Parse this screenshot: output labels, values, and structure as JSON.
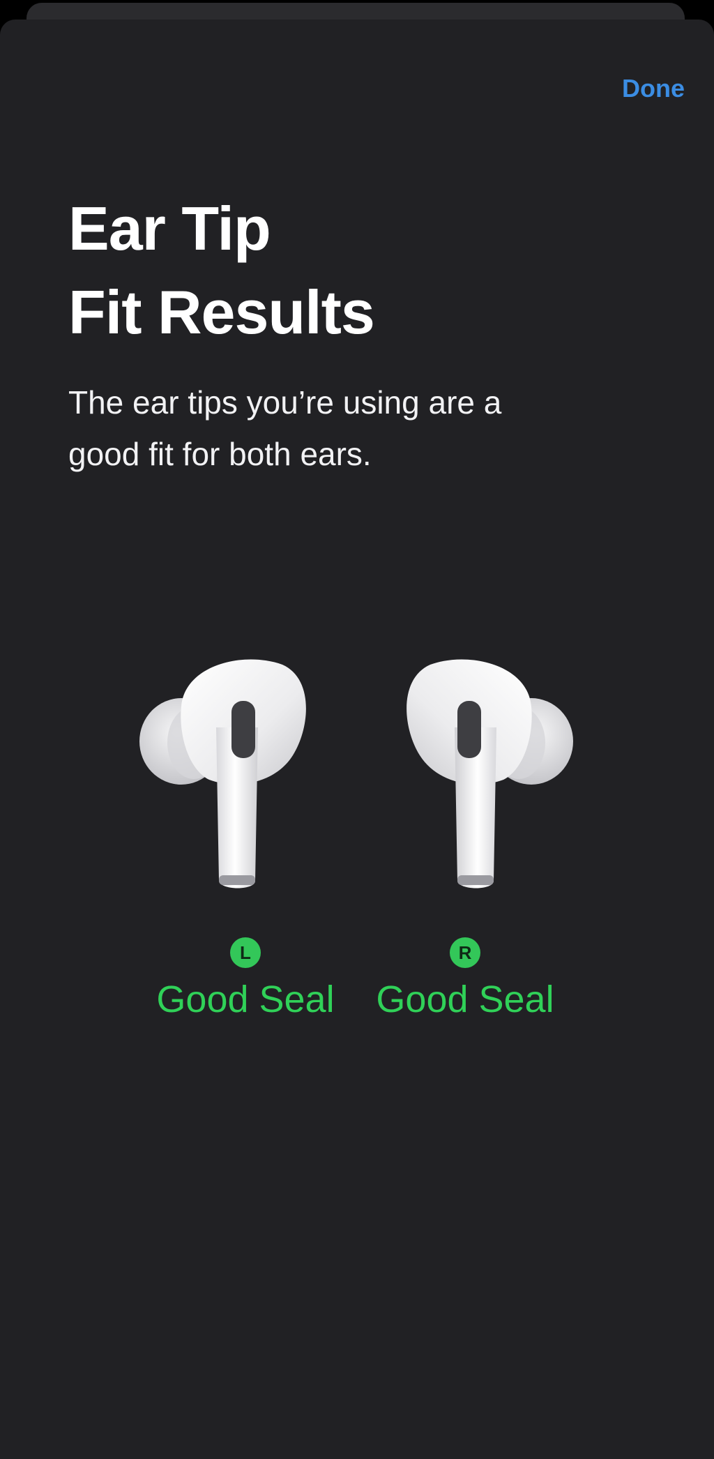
{
  "header": {
    "done_label": "Done"
  },
  "content": {
    "title_line1": "Ear Tip",
    "title_line2": "Fit Results",
    "subtitle_line1": "The ear tips you’re using are a",
    "subtitle_line2": "good fit for both ears."
  },
  "results": {
    "left": {
      "side": "L",
      "status": "Good Seal"
    },
    "right": {
      "side": "R",
      "status": "Good Seal"
    }
  },
  "colors": {
    "background": "#212124",
    "accent_blue": "#3b8de3",
    "seal_green": "#30d158"
  },
  "icons": {
    "left": "left-earbud-icon",
    "right": "right-earbud-icon"
  }
}
